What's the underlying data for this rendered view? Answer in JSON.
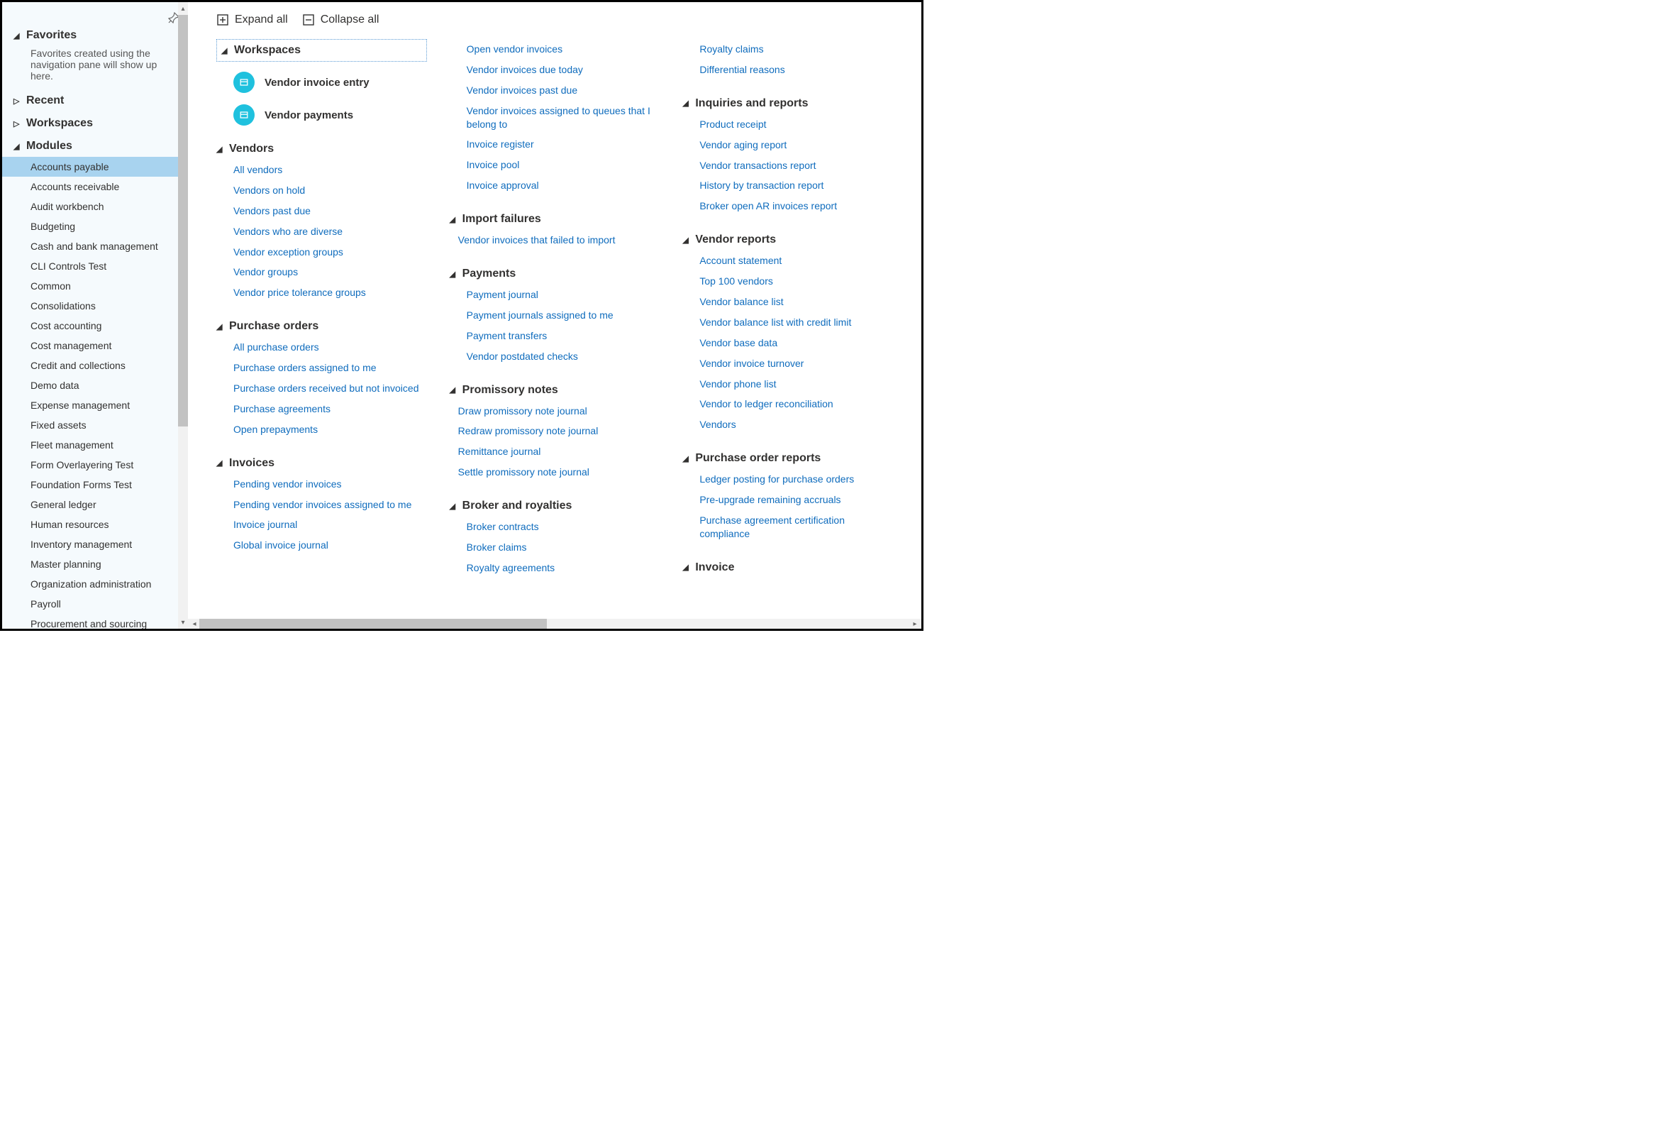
{
  "sidebar": {
    "favorites": {
      "label": "Favorites",
      "desc": "Favorites created using the navigation pane will show up here."
    },
    "recent": {
      "label": "Recent"
    },
    "workspaces": {
      "label": "Workspaces"
    },
    "modules": {
      "label": "Modules",
      "items": [
        "Accounts payable",
        "Accounts receivable",
        "Audit workbench",
        "Budgeting",
        "Cash and bank management",
        "CLI Controls Test",
        "Common",
        "Consolidations",
        "Cost accounting",
        "Cost management",
        "Credit and collections",
        "Demo data",
        "Expense management",
        "Fixed assets",
        "Fleet management",
        "Form Overlayering Test",
        "Foundation Forms Test",
        "General ledger",
        "Human resources",
        "Inventory management",
        "Master planning",
        "Organization administration",
        "Payroll",
        "Procurement and sourcing"
      ],
      "selectedIndex": 0
    }
  },
  "toolbar": {
    "expand": "Expand all",
    "collapse": "Collapse all"
  },
  "columns": [
    {
      "groups": [
        {
          "id": "workspaces",
          "header": "Workspaces",
          "ws": [
            {
              "icon": "invoice-entry-icon",
              "label": "Vendor invoice entry"
            },
            {
              "icon": "payments-icon",
              "label": "Vendor payments"
            }
          ]
        },
        {
          "id": "vendors",
          "header": "Vendors",
          "links": [
            "All vendors",
            "Vendors on hold",
            "Vendors past due",
            "Vendors who are diverse",
            "Vendor exception groups",
            "Vendor groups",
            "Vendor price tolerance groups"
          ]
        },
        {
          "id": "purchase-orders",
          "header": "Purchase orders",
          "links": [
            "All purchase orders",
            "Purchase orders assigned to me",
            "Purchase orders received but not invoiced",
            "Purchase agreements",
            "Open prepayments"
          ]
        },
        {
          "id": "invoices",
          "header": "Invoices",
          "links": [
            "Pending vendor invoices",
            "Pending vendor invoices assigned to me",
            "Invoice journal",
            "Global invoice journal"
          ]
        }
      ]
    },
    {
      "groups": [
        {
          "id": "invoices-cont",
          "links": [
            "Open vendor invoices",
            "Vendor invoices due today",
            "Vendor invoices past due",
            "Vendor invoices assigned to queues that I belong to",
            "Invoice register",
            "Invoice pool",
            "Invoice approval"
          ]
        },
        {
          "id": "import-failures",
          "header": "Import failures",
          "links": [
            "Vendor invoices that failed to import"
          ],
          "sub": true
        },
        {
          "id": "payments",
          "header": "Payments",
          "links": [
            "Payment journal",
            "Payment journals assigned to me",
            "Payment transfers",
            "Vendor postdated checks"
          ]
        },
        {
          "id": "promissory-notes",
          "header": "Promissory notes",
          "links": [
            "Draw promissory note journal",
            "Redraw promissory note journal",
            "Remittance journal",
            "Settle promissory note journal"
          ],
          "sub": true
        },
        {
          "id": "broker-royalties",
          "header": "Broker and royalties",
          "links": [
            "Broker contracts",
            "Broker claims",
            "Royalty agreements"
          ]
        }
      ]
    },
    {
      "groups": [
        {
          "id": "broker-cont",
          "links": [
            "Royalty claims",
            "Differential reasons"
          ]
        },
        {
          "id": "inquiries-reports",
          "header": "Inquiries and reports",
          "links": [
            "Product receipt",
            "Vendor aging report",
            "Vendor transactions report",
            "History by transaction report",
            "Broker open AR invoices report"
          ]
        },
        {
          "id": "vendor-reports",
          "header": "Vendor reports",
          "links": [
            "Account statement",
            "Top 100 vendors",
            "Vendor balance list",
            "Vendor balance list with credit limit",
            "Vendor base data",
            "Vendor invoice turnover",
            "Vendor phone list",
            "Vendor to ledger reconciliation",
            "Vendors"
          ]
        },
        {
          "id": "po-reports",
          "header": "Purchase order reports",
          "links": [
            "Ledger posting for purchase orders",
            "Pre-upgrade remaining accruals",
            "Purchase agreement certification compliance"
          ]
        },
        {
          "id": "invoice-reports",
          "header": "Invoice",
          "links": []
        }
      ]
    }
  ]
}
